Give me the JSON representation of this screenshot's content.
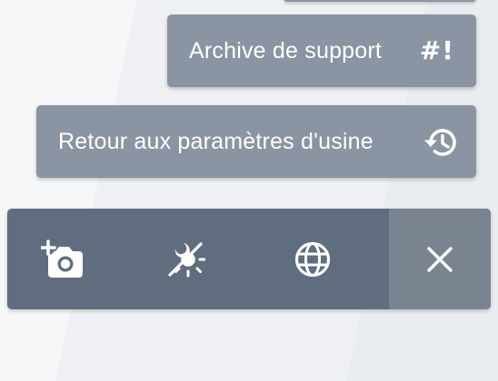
{
  "menu": {
    "items": [
      {
        "label": "Archive de support",
        "icon": "hash-exclamation-icon"
      },
      {
        "label": "Retour aux paramètres d'usine",
        "icon": "restore-history-icon"
      }
    ],
    "archive_glyph": "#!"
  },
  "toolbar": {
    "buttons": [
      {
        "icon": "add-photo-icon"
      },
      {
        "icon": "dark-mode-toggle-icon"
      },
      {
        "icon": "globe-icon"
      },
      {
        "icon": "close-icon"
      }
    ]
  },
  "colors": {
    "menu_button": "#8a94a2",
    "toolbar": "#5f6d7e",
    "close_button": "#7a8491",
    "text": "#ffffff",
    "background": "#eef0f3"
  }
}
